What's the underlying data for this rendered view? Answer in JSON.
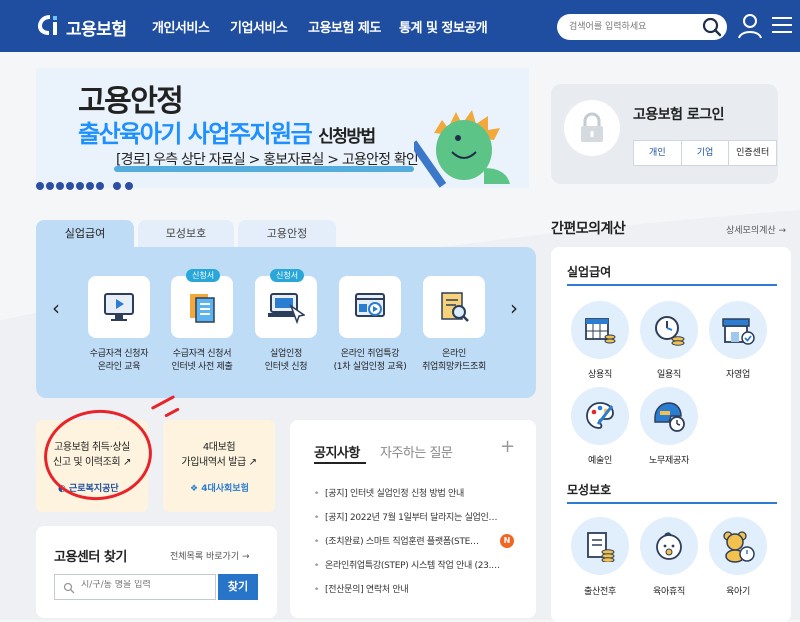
{
  "header": {
    "logo_text": "고용보험",
    "nav": [
      "개인서비스",
      "기업서비스",
      "고용보험 제도",
      "통계 및 정보공개"
    ],
    "search_placeholder": "검색어를 입력하세요"
  },
  "banner": {
    "title1": "고용안정",
    "title2": "출산육아기 사업주지원금",
    "title2_suffix": "신청방법",
    "route": "[경로] 우측 상단 자료실 > 홍보자료실 > 고용안정 확인"
  },
  "login": {
    "title": "고용보험 로그인",
    "buttons": [
      "개인",
      "기업",
      "인증센터"
    ]
  },
  "service_tabs": [
    "실업급여",
    "모성보호",
    "고용안정"
  ],
  "services": [
    {
      "badge": "",
      "label1": "수급자격 신청자",
      "label2": "온라인 교육",
      "icon": "monitor-video-icon"
    },
    {
      "badge": "신청서",
      "label1": "수급자격 신청서",
      "label2": "인터넷 사전 제출",
      "icon": "document-form-icon"
    },
    {
      "badge": "신청서",
      "label1": "실업인정",
      "label2": "인터넷 신청",
      "icon": "laptop-click-icon"
    },
    {
      "badge": "",
      "label1": "온라인 취업특강",
      "label2": "(1차 실업인정 교육)",
      "icon": "browser-video-icon"
    },
    {
      "badge": "",
      "label1": "온라인",
      "label2": "취업희망카드조회",
      "icon": "document-search-icon"
    }
  ],
  "quick": [
    {
      "line1": "고용보험 취득·상실",
      "line2": "신고 및 이력조회 ↗",
      "org": "근로복지공단"
    },
    {
      "line1": "4대보험",
      "line2": "가입내역서 발급 ↗",
      "org": "4대사회보험"
    }
  ],
  "finder": {
    "title": "고용센터 찾기",
    "link": "전체목록 바로가기 →",
    "placeholder": "시/구/동 명을 입력",
    "button": "찾기"
  },
  "notice": {
    "tab1": "공지사항",
    "tab2": "자주하는 질문",
    "plus": "+",
    "items": [
      "[공지] 인터넷 실업인정 신청 방법 안내",
      "[공지] 2022년 7월 1일부터 달라지는 실업인…",
      "(조치완료) 스마트 직업훈련 플랫폼(STE…",
      "온라인취업특강(STEP) 시스템 작업 안내 (23.…",
      "[전산문의] 연락처 안내"
    ],
    "new_badge": "N"
  },
  "simulator": {
    "title": "간편모의계산",
    "link": "상세모의계산 →",
    "section1": "실업급여",
    "section1_items": [
      {
        "label": "상용직",
        "icon": "calendar-coins-icon"
      },
      {
        "label": "일용직",
        "icon": "clock-coins-icon"
      },
      {
        "label": "자영업",
        "icon": "store-check-icon"
      },
      {
        "label": "예술인",
        "icon": "palette-brush-icon"
      },
      {
        "label": "노무제공자",
        "icon": "helmet-clock-icon"
      }
    ],
    "section2": "모성보호",
    "section2_items": [
      {
        "label": "출산전후",
        "icon": "document-coins-icon"
      },
      {
        "label": "육아휴직",
        "icon": "baby-face-icon"
      },
      {
        "label": "육아기",
        "icon": "teddy-bear-clock-icon"
      }
    ]
  },
  "colors": {
    "header_bg": "#1f4ea1",
    "panel_bg": "#bfdcf7",
    "accent": "#2a7dd1",
    "highlight": "#e8232a"
  }
}
